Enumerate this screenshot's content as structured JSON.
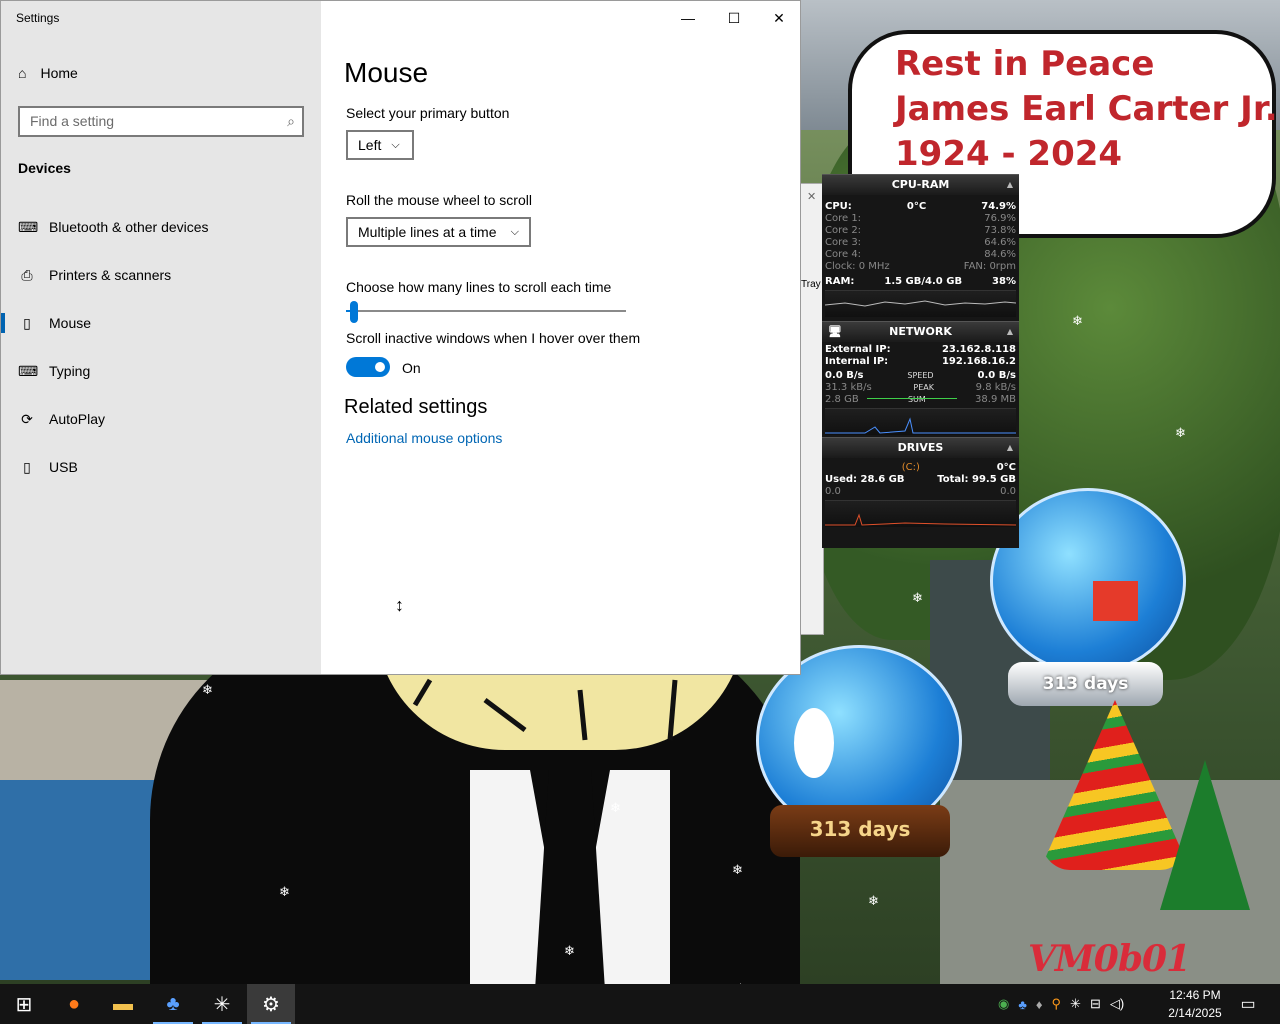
{
  "window": {
    "title": "Settings",
    "controls": {
      "minimize": "—",
      "maximize": "☐",
      "close": "✕"
    }
  },
  "sidebar": {
    "home_label": "Home",
    "search_placeholder": "Find a setting",
    "section_label": "Devices",
    "items": [
      {
        "label": "Bluetooth & other devices",
        "icon": "bluetooth-devices-icon"
      },
      {
        "label": "Printers & scanners",
        "icon": "printer-icon"
      },
      {
        "label": "Mouse",
        "icon": "mouse-icon",
        "active": true
      },
      {
        "label": "Typing",
        "icon": "keyboard-icon"
      },
      {
        "label": "AutoPlay",
        "icon": "autoplay-icon"
      },
      {
        "label": "USB",
        "icon": "usb-icon"
      }
    ]
  },
  "main": {
    "title": "Mouse",
    "primary_button_label": "Select your primary button",
    "primary_button_value": "Left",
    "scroll_label": "Roll the mouse wheel to scroll",
    "scroll_value": "Multiple lines at a time",
    "lines_label": "Choose how many lines to scroll each time",
    "lines_slider_fraction": 0.03,
    "inactive_label": "Scroll inactive windows when I hover over them",
    "inactive_state": "On",
    "related_title": "Related settings",
    "related_link": "Additional mouse options"
  },
  "desktop": {
    "rip_lines": [
      "Rest in Peace",
      "James Earl Carter Jr.",
      "1924 - 2024"
    ],
    "globe1_label": "313 days",
    "globe2_label": "313 days",
    "signature": "VM0b01",
    "tray_label": "Tray"
  },
  "gadget": {
    "cpu_title": "CPU-RAM",
    "cpu_label": "CPU:",
    "cpu_temp": "0°C",
    "cpu_value": "74.9%",
    "cores": [
      {
        "label": "Core 1:",
        "value": "76.9%"
      },
      {
        "label": "Core 2:",
        "value": "73.8%"
      },
      {
        "label": "Core 3:",
        "value": "64.6%"
      },
      {
        "label": "Core 4:",
        "value": "84.6%"
      }
    ],
    "clock": "Clock: 0 MHz",
    "fan": "FAN: 0rpm",
    "ram_label": "RAM:",
    "ram_value": "1.5 GB/4.0 GB",
    "ram_pct": "38%",
    "net_title": "NETWORK",
    "ext_ip_label": "External IP:",
    "ext_ip": "23.162.8.118",
    "int_ip_label": "Internal IP:",
    "int_ip": "192.168.16.2",
    "speed_in": "0.0 B/s",
    "speed_label": "SPEED",
    "speed_out": "0.0 B/s",
    "peak_in": "31.3 kB/s",
    "peak_label": "PEAK",
    "peak_out": "9.8 kB/s",
    "sum_in": "2.8 GB",
    "sum_label": "SUM",
    "sum_out": "38.9 MB",
    "drives_title": "DRIVES",
    "drive_name": "(C:)",
    "drive_temp": "0°C",
    "drive_used": "Used: 28.6 GB",
    "drive_total": "Total: 99.5 GB",
    "drive_read": "0.0",
    "drive_write": "0.0"
  },
  "taskbar": {
    "clock_time": "12:46 PM",
    "clock_date": "2/14/2025"
  },
  "colors": {
    "accent": "#0078d7",
    "link": "#0066b4",
    "sidebar_bg": "#e6e6e6",
    "rip_red": "#c0262c"
  }
}
